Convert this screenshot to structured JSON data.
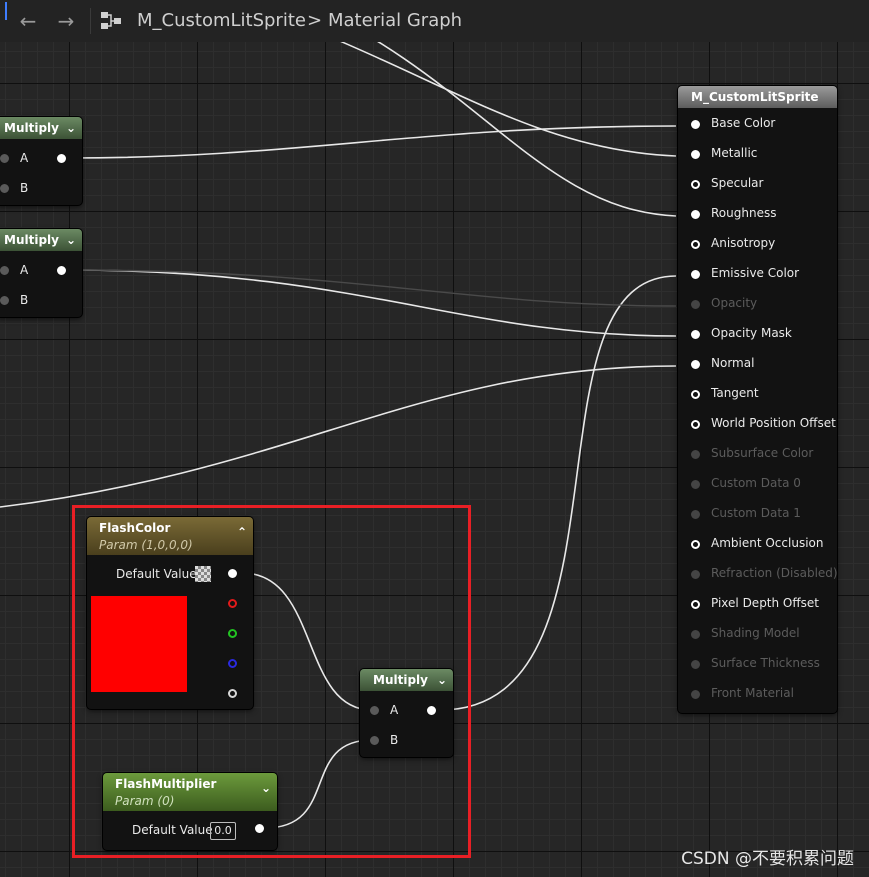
{
  "breadcrumb": {
    "asset": "M_CustomLitSprite",
    "separator": ">",
    "graph": "Material Graph"
  },
  "icons": {
    "back": "arrow-left-icon",
    "forward": "arrow-right-icon",
    "graph": "graph-icon"
  },
  "multiply_top": {
    "title": "Multiply",
    "pin_a": "A",
    "pin_b": "B"
  },
  "multiply_mid": {
    "title": "Multiply",
    "pin_a": "A",
    "pin_b": "B"
  },
  "flash_color": {
    "title": "FlashColor",
    "subtitle": "Param (1,0,0,0)",
    "default_label": "Default Value",
    "swatch_color": "#ff0000"
  },
  "flash_multiplier": {
    "title": "FlashMultiplier",
    "subtitle": "Param (0)",
    "default_label": "Default Value",
    "default_value": "0.0"
  },
  "multiply_main": {
    "title": "Multiply",
    "pin_a": "A",
    "pin_b": "B"
  },
  "result_node": {
    "title": "M_CustomLitSprite",
    "pins": [
      {
        "label": "Base Color",
        "enabled": true,
        "connected": true
      },
      {
        "label": "Metallic",
        "enabled": true,
        "connected": true
      },
      {
        "label": "Specular",
        "enabled": true,
        "connected": false
      },
      {
        "label": "Roughness",
        "enabled": true,
        "connected": true
      },
      {
        "label": "Anisotropy",
        "enabled": true,
        "connected": false
      },
      {
        "label": "Emissive Color",
        "enabled": true,
        "connected": true
      },
      {
        "label": "Opacity",
        "enabled": false,
        "connected": true
      },
      {
        "label": "Opacity Mask",
        "enabled": true,
        "connected": true
      },
      {
        "label": "Normal",
        "enabled": true,
        "connected": true
      },
      {
        "label": "Tangent",
        "enabled": true,
        "connected": false
      },
      {
        "label": "World Position Offset",
        "enabled": true,
        "connected": false
      },
      {
        "label": "Subsurface Color",
        "enabled": false,
        "connected": false
      },
      {
        "label": "Custom Data 0",
        "enabled": false,
        "connected": false
      },
      {
        "label": "Custom Data 1",
        "enabled": false,
        "connected": false
      },
      {
        "label": "Ambient Occlusion",
        "enabled": true,
        "connected": false
      },
      {
        "label": "Refraction (Disabled)",
        "enabled": false,
        "connected": false
      },
      {
        "label": "Pixel Depth Offset",
        "enabled": true,
        "connected": false
      },
      {
        "label": "Shading Model",
        "enabled": false,
        "connected": false
      },
      {
        "label": "Surface Thickness",
        "enabled": false,
        "connected": false
      },
      {
        "label": "Front Material",
        "enabled": false,
        "connected": false
      }
    ]
  },
  "highlight_color": "#e81f25",
  "watermark": "CSDN @不要积累问题"
}
